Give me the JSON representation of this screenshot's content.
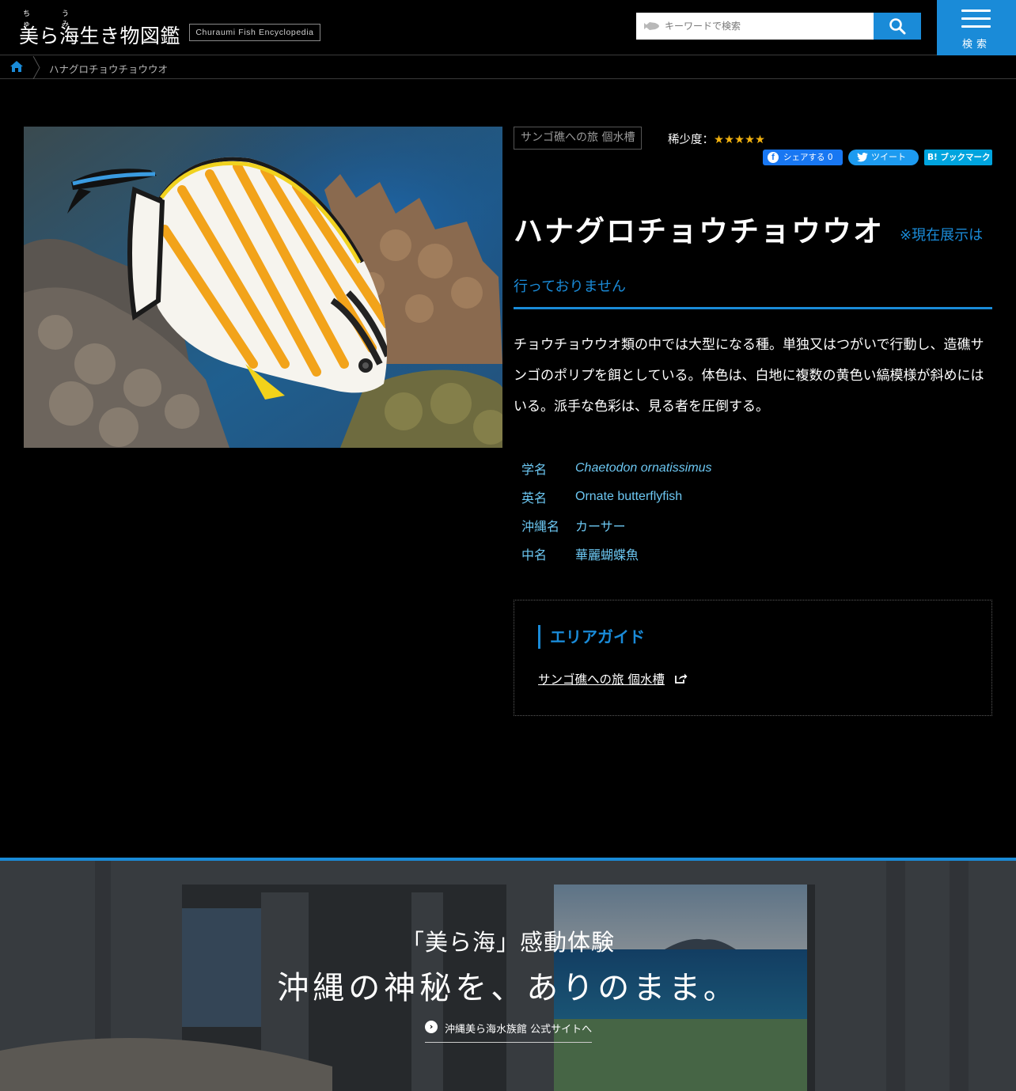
{
  "header": {
    "ruby_chu": "ちゅ",
    "ruby_umi": "うみ",
    "site_title": "美ら海生き物図鑑",
    "site_badge": "Churaumi Fish Encyclopedia",
    "search_placeholder": "キーワードで検索",
    "menu_label": "検索"
  },
  "breadcrumb": {
    "current": "ハナグロチョウチョウウオ"
  },
  "fish": {
    "area_tag": "サンゴ礁への旅 個水槽",
    "rarity_label": "稀少度：",
    "rarity_stars": "★★★★★",
    "rarity_value": 5,
    "rarity_max": 5,
    "share": {
      "facebook": "シェアする 0",
      "twitter": "ツイート",
      "hatena": "B! ブックマーク"
    },
    "title": "ハナグロチョウチョウウオ",
    "notice_part1": "※現在展示は",
    "notice_part2": "行っておりません",
    "description": "チョウチョウウオ類の中では大型になる種。単独又はつがいで行動し、造礁サンゴのポリプを餌としている。体色は、白地に複数の黄色い縞模様が斜めにはいる。派手な色彩は、見る者を圧倒する。",
    "names": [
      {
        "key": "学名",
        "value": "Chaetodon ornatissimus"
      },
      {
        "key": "英名",
        "value": "Ornate butterflyfish"
      },
      {
        "key": "沖縄名",
        "value": "カーサー"
      },
      {
        "key": "中名",
        "value": "華麗蝴蝶魚"
      }
    ]
  },
  "area_guide": {
    "heading": "エリアガイド",
    "link": "サンゴ礁への旅 個水槽"
  },
  "banner": {
    "subtitle": "「美ら海」感動体験",
    "title": "沖縄の神秘を、ありのまま。",
    "link": "沖縄美ら海水族館 公式サイトへ"
  },
  "colors": {
    "accent": "#1a8bd8",
    "star": "#f2b20f",
    "name_text": "#6cc7f2",
    "background": "#000000"
  },
  "icons": [
    "home-icon",
    "search-icon",
    "menu-icon",
    "fish-icon",
    "external-link-icon",
    "facebook-icon",
    "twitter-icon",
    "arrow-right-icon"
  ]
}
